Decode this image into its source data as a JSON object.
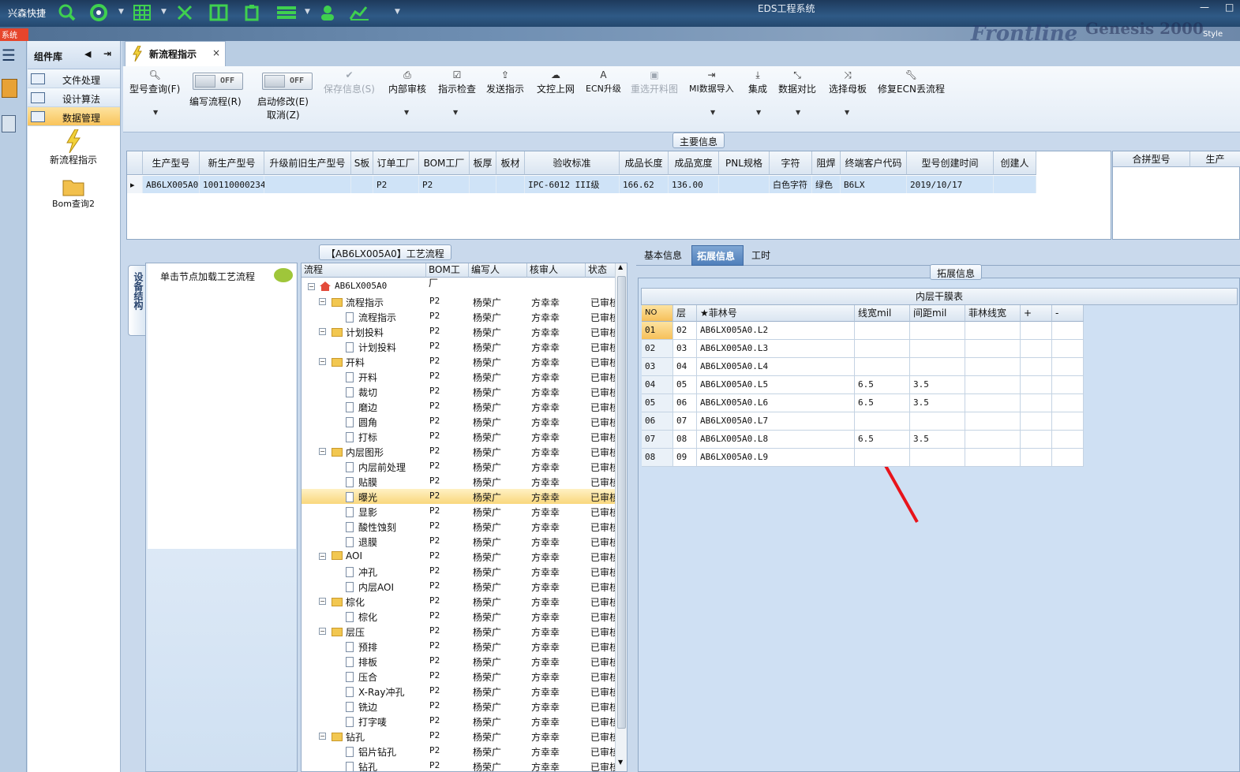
{
  "titlebar": {
    "quick_name": "兴森快捷",
    "window_title": "EDS工程系统",
    "icons": [
      "search-icon",
      "lifebuoy-icon",
      "grid-icon",
      "scissors-icon",
      "film-icon",
      "clipboard-icon",
      "list-icon",
      "user-icon",
      "chart-icon"
    ]
  },
  "menubar": {
    "system_label": "系统",
    "brand": "Frontline",
    "brand2": "Genesis 2000",
    "style_label": "Style"
  },
  "component_panel": {
    "title": "组件库",
    "items": [
      {
        "label": "文件处理"
      },
      {
        "label": "设计算法"
      },
      {
        "label": "数据管理"
      }
    ],
    "sub_items": [
      {
        "label": "新流程指示"
      },
      {
        "label": "Bom查询2"
      }
    ]
  },
  "tab": {
    "label": "新流程指示",
    "close": "×"
  },
  "toolbar": {
    "query": "型号查询(F)",
    "write_flow": "编写流程(R)",
    "start_modify": "启动修改(E)",
    "cancel": "取消(Z)",
    "toggle_off": "OFF",
    "save": "保存信息(S)",
    "internal_review": "内部审核",
    "check": "指示检查",
    "send": "发送指示",
    "doc_upload": "文控上网",
    "ecn_upgrade": "ECN升级",
    "reselect": "重选开料图",
    "mi_import": "MI数据导入",
    "integrate": "集成",
    "compare": "数据对比",
    "select_master": "选择母板",
    "repair_ecn": "修复ECN丢流程"
  },
  "main_info": {
    "title": "主要信息",
    "columns": [
      "生产型号",
      "新生产型号",
      "升级前旧生产型号",
      "S板",
      "订单工厂",
      "BOM工厂",
      "板厚",
      "板材",
      "验收标准",
      "成品长度",
      "成品宽度",
      "PNL规格",
      "字符",
      "阻焊",
      "终端客户代码",
      "型号创建时间",
      "创建人"
    ],
    "row": [
      "AB6LX005A0",
      "10011000023444",
      "",
      "",
      "P2",
      "P2",
      "",
      "",
      "IPC-6012 III级",
      "166.62",
      "136.00",
      "",
      "白色字符",
      "绿色",
      "B6LX",
      "2019/10/17",
      ""
    ],
    "side_columns": [
      "合拼型号",
      "生产"
    ]
  },
  "flow": {
    "title": "【AB6LX005A0】工艺流程",
    "side_tab": "设备结构",
    "hint": "单击节点加载工艺流程",
    "columns": [
      "流程",
      "BOM工厂",
      "编写人",
      "核审人",
      "状态"
    ],
    "root": "AB6LX005A0",
    "rows": [
      {
        "name": "流程指示",
        "level": 1,
        "folder": true
      },
      {
        "name": "流程指示",
        "level": 2,
        "folder": false
      },
      {
        "name": "计划投料",
        "level": 1,
        "folder": true
      },
      {
        "name": "计划投料",
        "level": 2,
        "folder": false
      },
      {
        "name": "开料",
        "level": 1,
        "folder": true
      },
      {
        "name": "开料",
        "level": 2,
        "folder": false
      },
      {
        "name": "裁切",
        "level": 2,
        "folder": false
      },
      {
        "name": "磨边",
        "level": 2,
        "folder": false
      },
      {
        "name": "圆角",
        "level": 2,
        "folder": false
      },
      {
        "name": "打标",
        "level": 2,
        "folder": false
      },
      {
        "name": "内层图形",
        "level": 1,
        "folder": true
      },
      {
        "name": "内层前处理",
        "level": 2,
        "folder": false
      },
      {
        "name": "贴膜",
        "level": 2,
        "folder": false
      },
      {
        "name": "曝光",
        "level": 2,
        "folder": false,
        "selected": true
      },
      {
        "name": "显影",
        "level": 2,
        "folder": false
      },
      {
        "name": "酸性蚀刻",
        "level": 2,
        "folder": false
      },
      {
        "name": "退膜",
        "level": 2,
        "folder": false
      },
      {
        "name": "AOI",
        "level": 1,
        "folder": true
      },
      {
        "name": "冲孔",
        "level": 2,
        "folder": false
      },
      {
        "name": "内层AOI",
        "level": 2,
        "folder": false
      },
      {
        "name": "棕化",
        "level": 1,
        "folder": true
      },
      {
        "name": "棕化",
        "level": 2,
        "folder": false
      },
      {
        "name": "层压",
        "level": 1,
        "folder": true
      },
      {
        "name": "预排",
        "level": 2,
        "folder": false
      },
      {
        "name": "排板",
        "level": 2,
        "folder": false
      },
      {
        "name": "压合",
        "level": 2,
        "folder": false
      },
      {
        "name": "X-Ray冲孔",
        "level": 2,
        "folder": false
      },
      {
        "name": "铣边",
        "level": 2,
        "folder": false
      },
      {
        "name": "打字唛",
        "level": 2,
        "folder": false
      },
      {
        "name": "钻孔",
        "level": 1,
        "folder": true
      },
      {
        "name": "铝片钻孔",
        "level": 2,
        "folder": false
      },
      {
        "name": "钻孔",
        "level": 2,
        "folder": false
      }
    ],
    "bom": "P2",
    "writer": "杨荣广",
    "reviewer": "方幸幸",
    "status": "已审核"
  },
  "right": {
    "tabs": [
      "基本信息",
      "拓展信息",
      "工时"
    ],
    "active_tab": 1,
    "section_title": "拓展信息",
    "table_title": "内层干膜表",
    "columns": [
      "NO",
      "层",
      "★菲林号",
      "线宽mil",
      "间距mil",
      "菲林线宽",
      "+",
      "-"
    ],
    "rows": [
      [
        "01",
        "02",
        "AB6LX005A0.L2",
        "",
        "",
        ""
      ],
      [
        "02",
        "03",
        "AB6LX005A0.L3",
        "",
        "",
        ""
      ],
      [
        "03",
        "04",
        "AB6LX005A0.L4",
        "",
        "",
        ""
      ],
      [
        "04",
        "05",
        "AB6LX005A0.L5",
        "6.5",
        "3.5",
        ""
      ],
      [
        "05",
        "06",
        "AB6LX005A0.L6",
        "6.5",
        "3.5",
        ""
      ],
      [
        "06",
        "07",
        "AB6LX005A0.L7",
        "",
        "",
        ""
      ],
      [
        "07",
        "08",
        "AB6LX005A0.L8",
        "6.5",
        "3.5",
        ""
      ],
      [
        "08",
        "09",
        "AB6LX005A0.L9",
        "",
        "",
        ""
      ]
    ]
  }
}
